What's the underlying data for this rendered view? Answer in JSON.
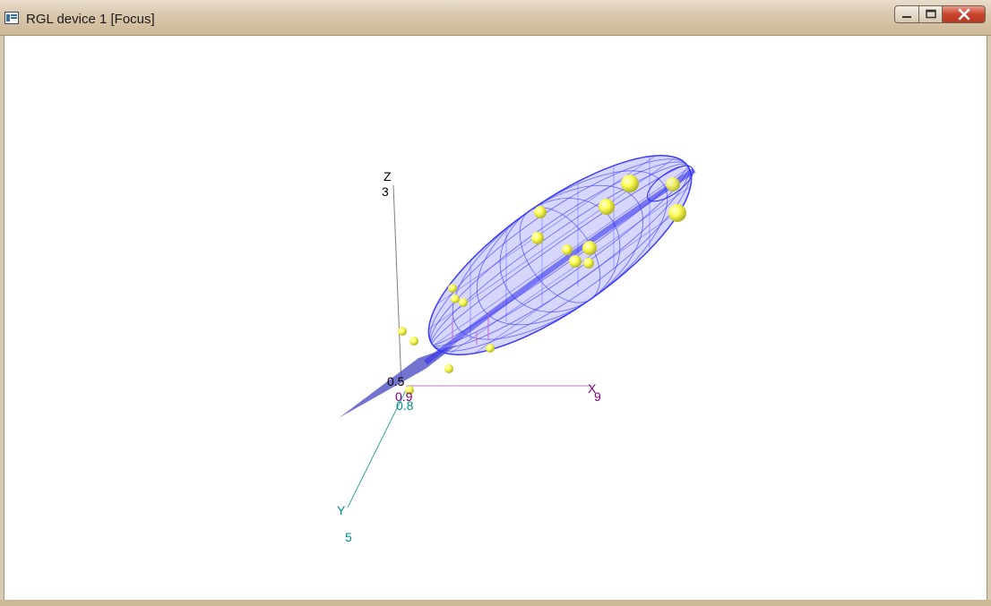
{
  "window": {
    "title": "RGL device 1 [Focus]"
  },
  "colors": {
    "ellipsoid": "#3b3bff",
    "points": "#ffff66",
    "x_axis": "#800080",
    "y_axis": "#008b8b",
    "z_axis": "#000000"
  },
  "axes": {
    "x": {
      "label": "X",
      "min_tick": "0.9",
      "max_tick": "9"
    },
    "y": {
      "label": "Y",
      "min_tick": "0.8",
      "max_tick": "5"
    },
    "z": {
      "label": "Z",
      "min_tick": "0.5",
      "max_tick": "3"
    }
  },
  "icons": {
    "app": "rgl-window-icon",
    "minimize": "minimize-icon",
    "maximize": "maximize-icon",
    "close": "close-icon"
  }
}
